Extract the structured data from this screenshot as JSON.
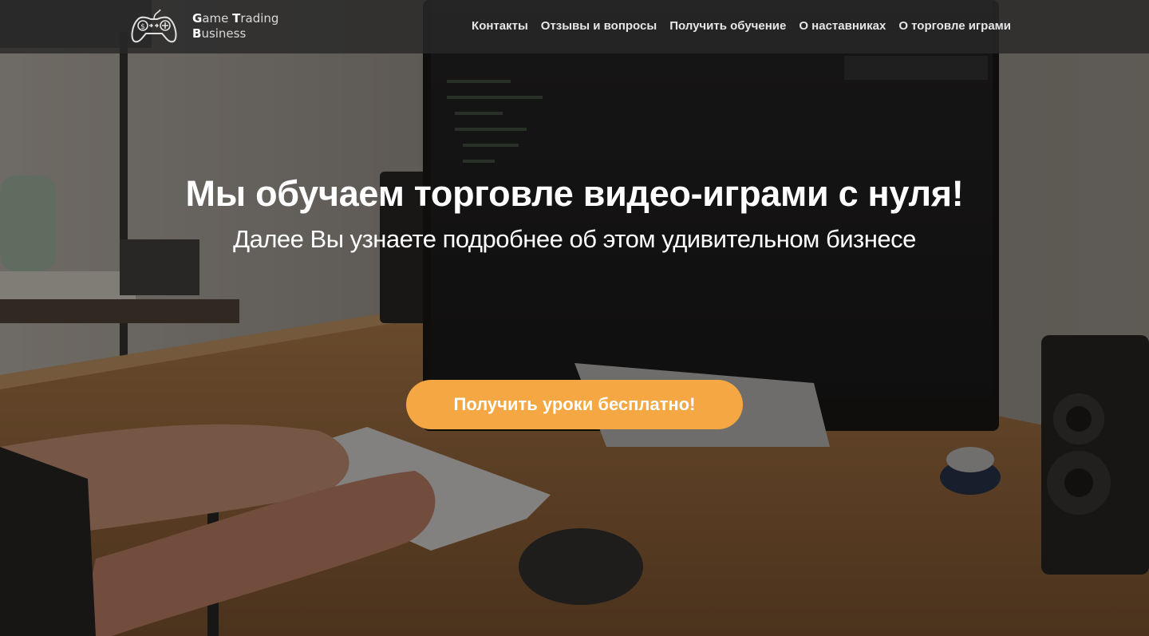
{
  "header": {
    "logo": {
      "icon": "gamepad-dollar-icon",
      "line1": {
        "first_letter": "G",
        "rest1": "ame ",
        "second_letter": "T",
        "rest2": "rading"
      },
      "line2": {
        "first_letter": "B",
        "rest": "usiness"
      }
    },
    "nav": [
      {
        "label": "Контакты"
      },
      {
        "label": "Отзывы и вопросы"
      },
      {
        "label": "Получить обучение"
      },
      {
        "label": "О наставниках"
      },
      {
        "label": "О торговле играми"
      }
    ]
  },
  "hero": {
    "background": "desk-with-monitor-keyboard-mouse-speakers-photo",
    "title": "Мы обучаем торговле видео-играми с нуля!",
    "subtitle": "Далее Вы узнаете подробнее об этом удивительном бизнесе",
    "cta_label": "Получить уроки бесплатно!"
  },
  "colors": {
    "accent": "#f4a742",
    "header_bg": "#282828",
    "text_light": "#ffffff"
  }
}
